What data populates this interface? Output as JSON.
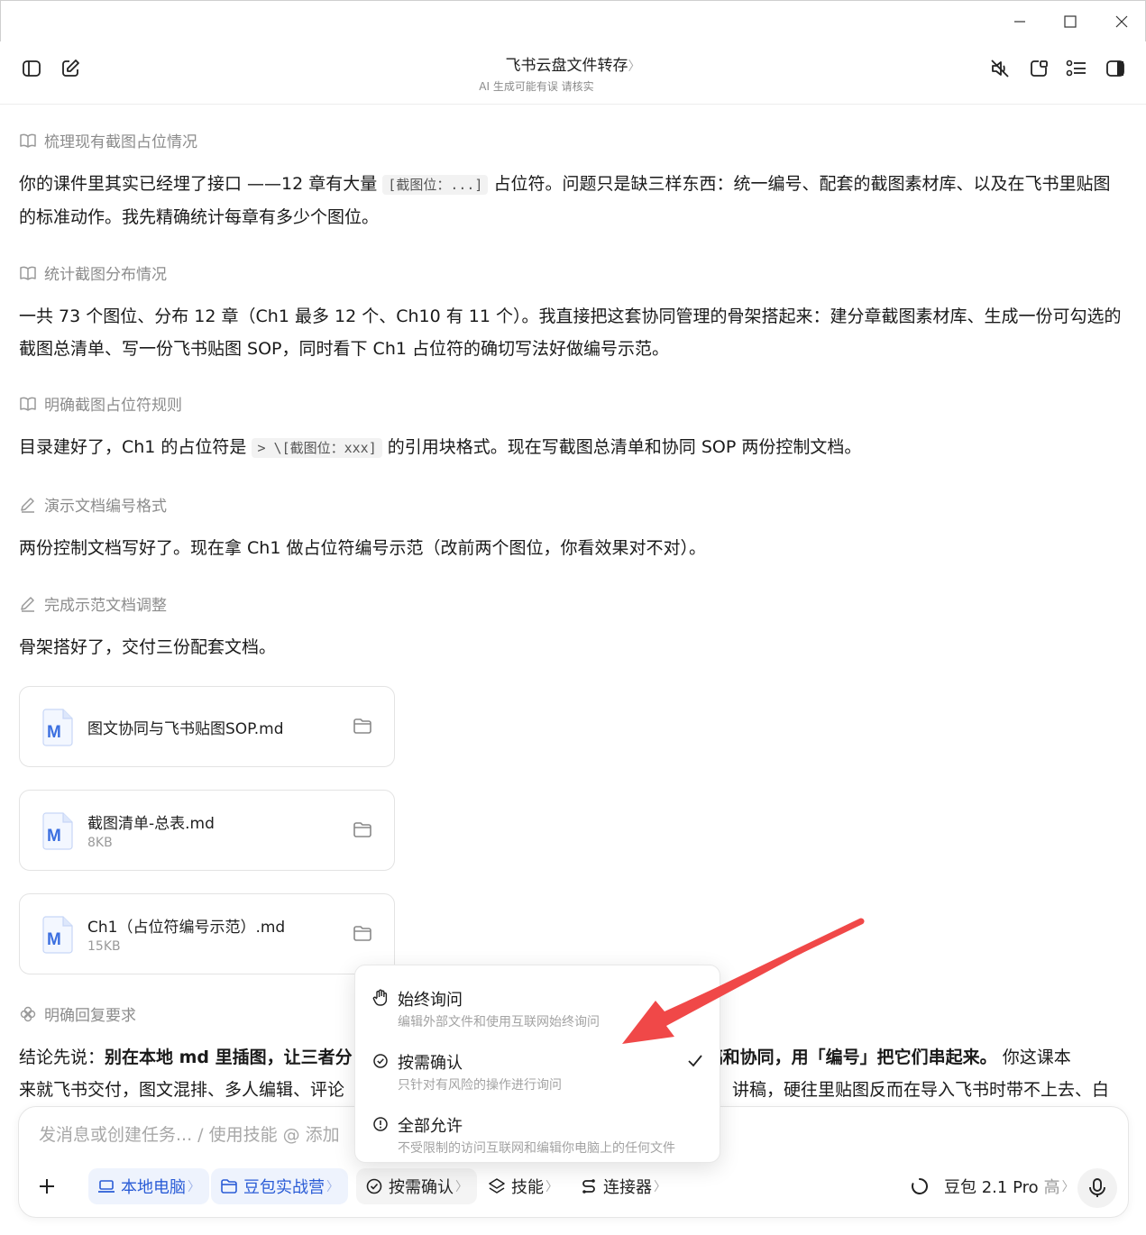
{
  "header": {
    "title": "飞书云盘文件转存",
    "title_chevron": "〉",
    "subtitle": "AI 生成可能有误 请核实"
  },
  "messages": {
    "step1": "梳理现有截图占位情况",
    "p1_a": "你的课件里其实已经埋了接口 ——12 章有大量 ",
    "p1_code": "[截图位：...]",
    "p1_b": " 占位符。问题只是缺三样东西：统一编号、配套的截图素材库、以及在飞书里贴图的标准动作。我先精确统计每章有多少个图位。",
    "step2": "统计截图分布情况",
    "p2": "一共 73 个图位、分布 12 章（Ch1 最多 12 个、Ch10 有 11 个）。我直接把这套协同管理的骨架搭起来：建分章截图素材库、生成一份可勾选的截图总清单、写一份飞书贴图 SOP，同时看下 Ch1 占位符的确切写法好做编号示范。",
    "step3": "明确截图占位符规则",
    "p3_a": "目录建好了，Ch1 的占位符是 ",
    "p3_code": "> \\[截图位：xxx]",
    "p3_b": " 的引用块格式。现在写截图总清单和协同 SOP 两份控制文档。",
    "step4": "演示文档编号格式",
    "p4": "两份控制文档写好了。现在拿 Ch1 做占位符编号示范（改前两个图位，你看效果对不对）。",
    "step5": "完成示范文档调整",
    "p5": "骨架搭好了，交付三份配套文档。",
    "step6": "明确回复要求",
    "p6_a": "结论先说：",
    "p6_bold1": "别在本地 md 里插图，让三者分",
    "p6_bold2": "成稿和协同，用「编号」把它们串起来。",
    "p6_b": " 你这课本",
    "p7_a": "来就飞书交付，图文混排、多人编辑、评论",
    "p7_b": "讲稿，硬往里贴图反而在导入飞书时带不上去、白"
  },
  "files": [
    {
      "name": "图文协同与飞书贴图SOP.md",
      "size": ""
    },
    {
      "name": "截图清单-总表.md",
      "size": "8KB"
    },
    {
      "name": "Ch1（占位符编号示范）.md",
      "size": "15KB"
    }
  ],
  "popup": {
    "options": [
      {
        "label": "始终询问",
        "desc": "编辑外部文件和使用互联网始终询问"
      },
      {
        "label": "按需确认",
        "desc": "只针对有风险的操作进行询问"
      },
      {
        "label": "全部允许",
        "desc": "不受限制的访问互联网和编辑你电脑上的任何文件"
      }
    ]
  },
  "composer": {
    "placeholder": "发消息或创建任务... / 使用技能 @ 添加",
    "local_pc": "本地电脑",
    "project": "豆包实战营",
    "permission": "按需确认",
    "skills": "技能",
    "connectors": "连接器",
    "model": "豆包 2.1 Pro",
    "model_level": "高",
    "chevron": "〉"
  },
  "colors": {
    "accent_blue": "#2a5cd6",
    "arrow_red": "#f04848",
    "muted_text": "#8c8c8c"
  }
}
